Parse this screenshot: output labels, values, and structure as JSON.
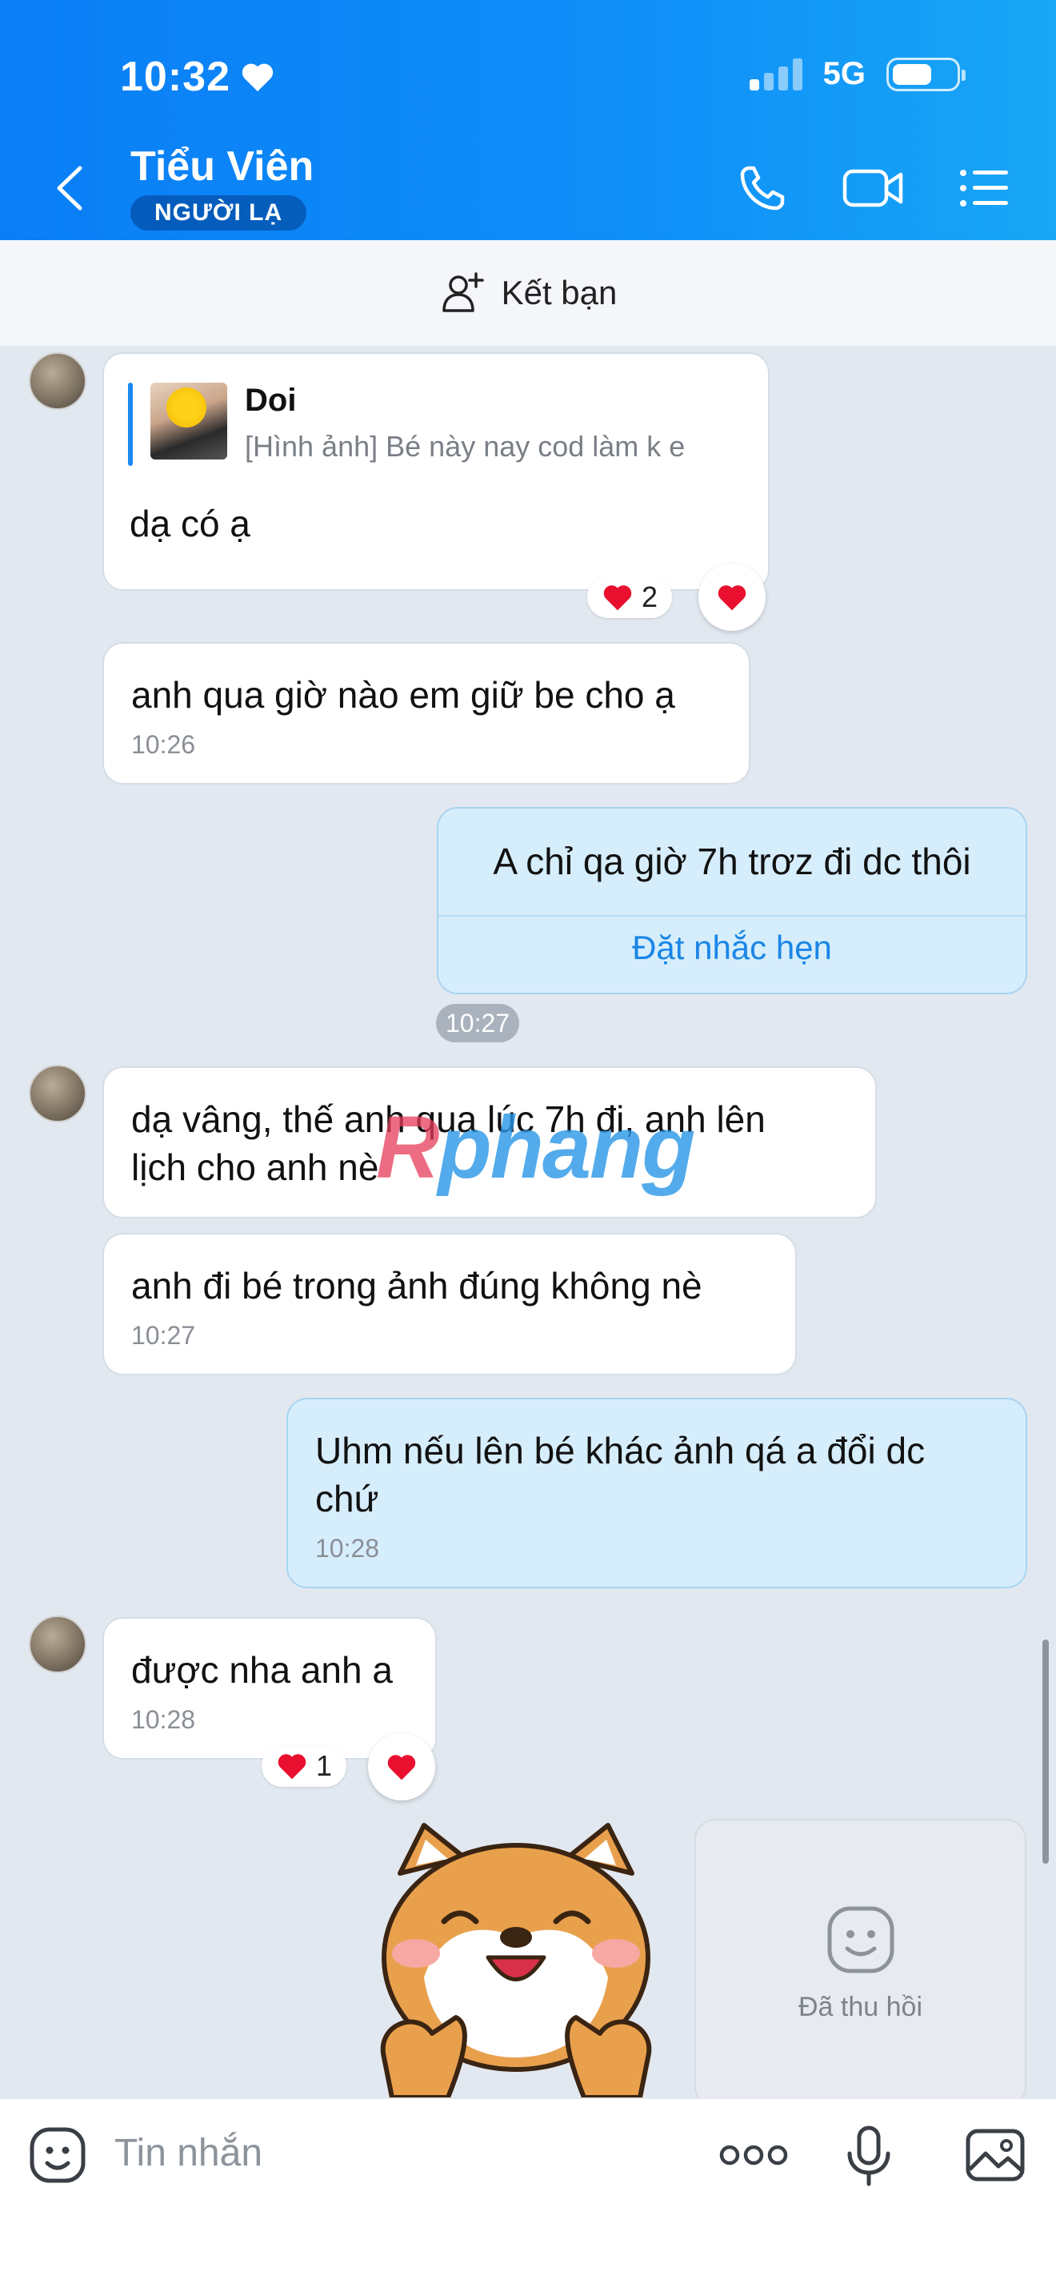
{
  "status_bar": {
    "time": "10:32",
    "network": "5G"
  },
  "header": {
    "contact_name": "Tiểu Viên",
    "badge": "NGƯỜI LẠ"
  },
  "friend_bar": {
    "label": "Kết bạn"
  },
  "messages": {
    "m1": {
      "quote_name": "Doi",
      "quote_text": "[Hình ảnh] Bé này nay cod làm k e",
      "text": "dạ có ạ",
      "reaction_count": "2"
    },
    "m2": {
      "text": "anh qua giờ nào em giữ be cho ạ",
      "time": "10:26"
    },
    "m3": {
      "text": "A chỉ qa giờ 7h trơz đi dc thôi",
      "action": "Đặt nhắc hẹn",
      "time": "10:27"
    },
    "m4": {
      "text_line1": "dạ vâng, thế anh qua lúc 7h đi, anh lên",
      "text_line2": "lịch cho anh nè"
    },
    "m5": {
      "text": "anh đi bé trong ảnh đúng không nè",
      "time": "10:27"
    },
    "m6": {
      "text_line1": "Uhm nếu lên bé khác ảnh qá a đổi dc",
      "text_line2": "chứ",
      "time": "10:28"
    },
    "m7": {
      "text": "được nha anh a",
      "time": "10:28",
      "reaction_count": "1"
    },
    "recalled": {
      "label": "Đã thu hồi"
    }
  },
  "watermark": {
    "part1": "R",
    "part2": "phang"
  },
  "input": {
    "placeholder": "Tin nhắn"
  },
  "colors": {
    "header_blue": "#0a7ef6",
    "my_bubble": "#d6edfc",
    "link_blue": "#1a86e6",
    "heart_red": "#e8102e"
  }
}
